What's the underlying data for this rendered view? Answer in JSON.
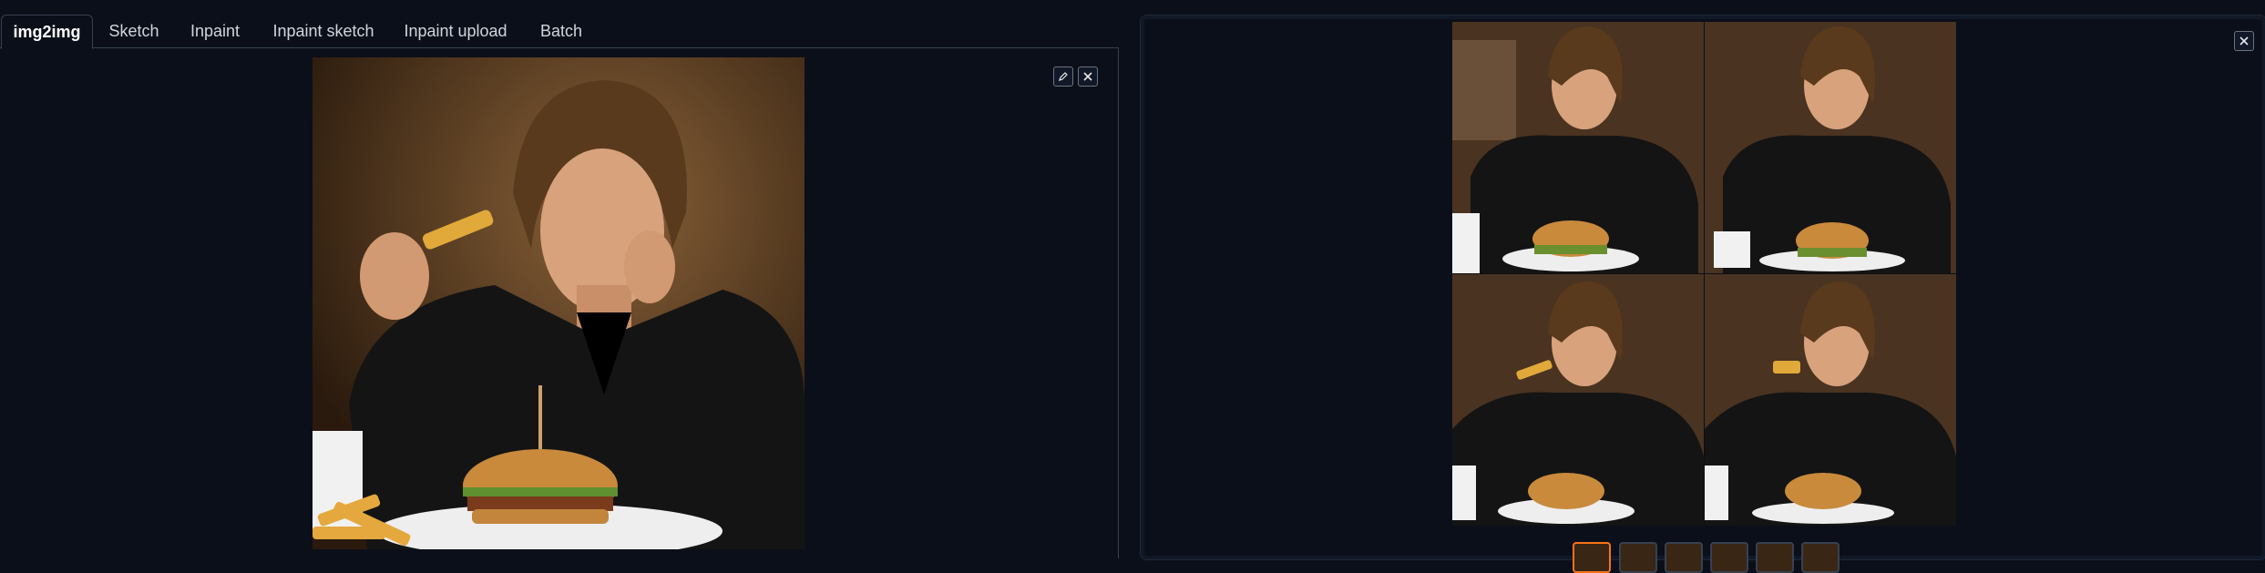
{
  "tabs": [
    {
      "label": "img2img",
      "active": true
    },
    {
      "label": "Sketch",
      "active": false
    },
    {
      "label": "Inpaint",
      "active": false
    },
    {
      "label": "Inpaint sketch",
      "active": false
    },
    {
      "label": "Inpaint upload",
      "active": false
    },
    {
      "label": "Batch",
      "active": false
    }
  ],
  "input_image": {
    "edit_icon": "pencil-icon",
    "clear_icon": "close-icon"
  },
  "output_gallery": {
    "close_icon": "close-icon",
    "grid_images": 4,
    "thumbnail_count": 6,
    "selected_thumbnail": 1
  },
  "colors": {
    "background": "#0b0f19",
    "border": "#374151",
    "accent": "#f97316"
  }
}
